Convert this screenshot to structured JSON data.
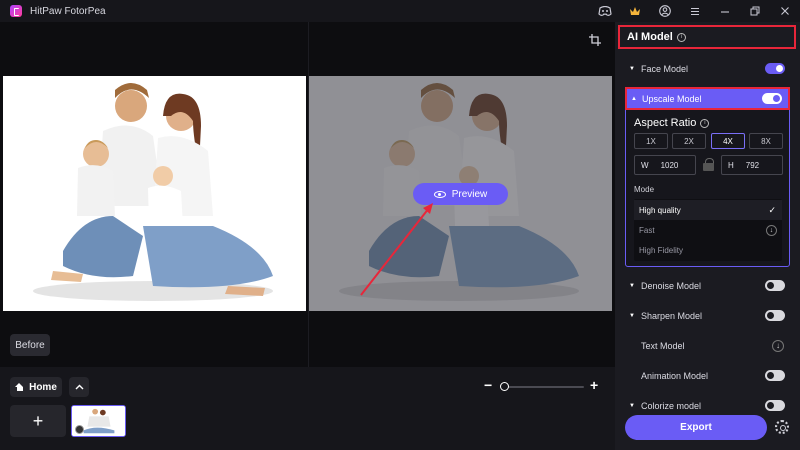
{
  "app": {
    "title": "HitPaw FotorPea"
  },
  "titlebar_icons": [
    "discord-icon",
    "premium-icon",
    "account-icon",
    "menu-icon",
    "minimize-icon",
    "maximize-icon",
    "close-icon"
  ],
  "canvas": {
    "preview_label": "Preview",
    "before_label": "Before"
  },
  "bottom": {
    "home_label": "Home",
    "add_label": "+",
    "zoom_level": 0.0
  },
  "panel": {
    "title": "AI Model",
    "models": {
      "face": {
        "label": "Face Model",
        "enabled": true
      },
      "upscale": {
        "label": "Upscale Model",
        "enabled": true
      },
      "denoise": {
        "label": "Denoise Model",
        "enabled": false
      },
      "sharpen": {
        "label": "Sharpen Model",
        "enabled": false
      },
      "text": {
        "label": "Text Model"
      },
      "animation": {
        "label": "Animation Model",
        "enabled": false
      },
      "colorize": {
        "label": "Colorize model",
        "enabled": false
      }
    },
    "aspect_ratio": {
      "title": "Aspect Ratio",
      "options": [
        "1X",
        "2X",
        "4X",
        "8X"
      ],
      "selected": "4X",
      "width_label": "W",
      "width": "1020",
      "height_label": "H",
      "height": "792"
    },
    "mode": {
      "label": "Mode",
      "options": [
        "High quality",
        "Fast",
        "High Fidelity"
      ],
      "selected": "High quality"
    },
    "export_label": "Export"
  },
  "colors": {
    "accent": "#6a5cf5",
    "highlight": "#e8263a",
    "panel_bg": "#1b1b21"
  }
}
